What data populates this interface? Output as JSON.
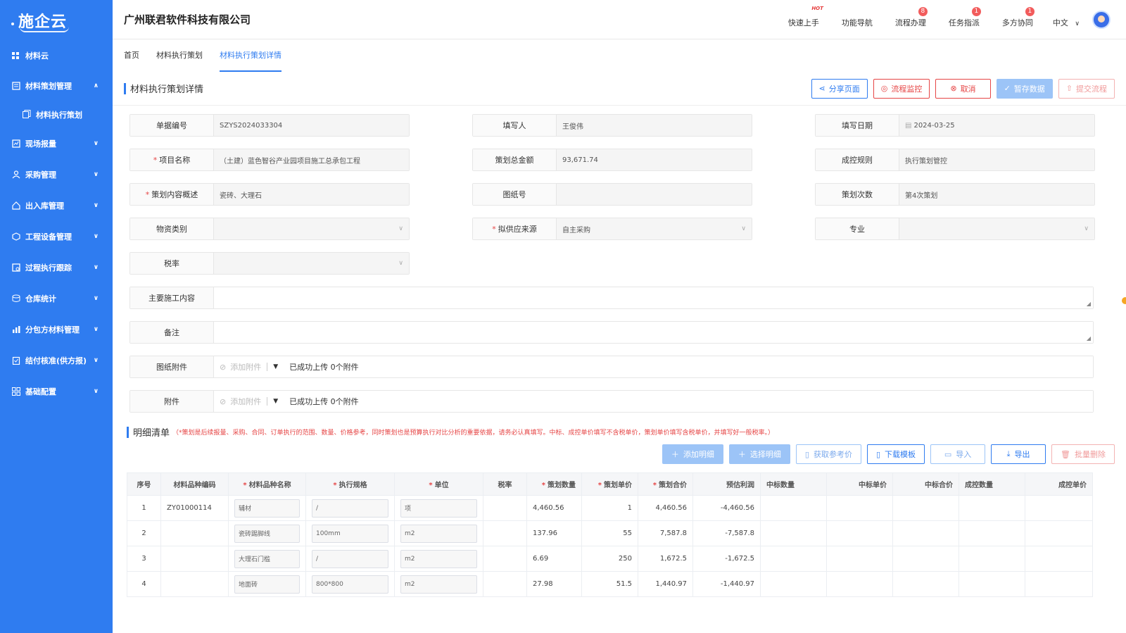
{
  "logo": {
    "text": "施企云"
  },
  "sidebar": {
    "items": [
      {
        "label": "材料云",
        "icon": "grid-icon",
        "chevron": ""
      },
      {
        "label": "材料策划管理",
        "icon": "ledger-icon",
        "chevron": "∧"
      },
      {
        "label": "材料执行策划",
        "icon": "doc-stack-icon",
        "chevron": ""
      },
      {
        "label": "现场报量",
        "icon": "report-icon",
        "chevron": "∨"
      },
      {
        "label": "采购管理",
        "icon": "people-icon",
        "chevron": "∨"
      },
      {
        "label": "出入库管理",
        "icon": "home-icon",
        "chevron": "∨"
      },
      {
        "label": "工程设备管理",
        "icon": "cube-icon",
        "chevron": "∨"
      },
      {
        "label": "过程执行跟踪",
        "icon": "track-icon",
        "chevron": "∨"
      },
      {
        "label": "仓库统计",
        "icon": "stack-icon",
        "chevron": "∨"
      },
      {
        "label": "分包方材料管理",
        "icon": "chart-icon",
        "chevron": "∨"
      },
      {
        "label": "结付核准(供方报)",
        "icon": "clipboard-icon",
        "chevron": "∨"
      },
      {
        "label": "基础配置",
        "icon": "apps-icon",
        "chevron": "∨"
      }
    ]
  },
  "header": {
    "company": "广州联君软件科技有限公司",
    "links": [
      {
        "label": "快速上手",
        "badge": "",
        "hot": "HOT"
      },
      {
        "label": "功能导航",
        "badge": "",
        "hot": ""
      },
      {
        "label": "流程办理",
        "badge": "8",
        "hot": ""
      },
      {
        "label": "任务指派",
        "badge": "1",
        "hot": ""
      },
      {
        "label": "多方协同",
        "badge": "1",
        "hot": ""
      }
    ],
    "lang": "中文"
  },
  "tabs": [
    {
      "label": "首页"
    },
    {
      "label": "材料执行策划"
    },
    {
      "label": "材料执行策划详情"
    }
  ],
  "page": {
    "title": "材料执行策划详情",
    "buttons": {
      "share": "分享页面",
      "flow": "流程监控",
      "cancel": "取消",
      "save": "暂存数据",
      "submit": "提交流程"
    }
  },
  "form": {
    "doc_no_label": "单据编号",
    "doc_no": "SZYS2024033304",
    "writer_label": "填写人",
    "writer": "王俊伟",
    "date_label": "填写日期",
    "date": "2024-03-25",
    "project_label": "项目名称",
    "project": "（土建）蓝色智谷产业园项目施工总承包工程",
    "total_label": "策划总金额",
    "total": "93,671.74",
    "rule_label": "成控规则",
    "rule": "执行策划管控",
    "summary_label": "策划内容概述",
    "summary": "瓷砖、大理石",
    "drawing_no_label": "图纸号",
    "drawing_no": "",
    "times_label": "策划次数",
    "times": "第4次策划",
    "category_label": "物资类别",
    "category": "",
    "source_label": "拟供应来源",
    "source": "自主采购",
    "major_label": "专业",
    "major": "",
    "tax_label": "税率",
    "tax": "",
    "main_content_label": "主要施工内容",
    "main_content": "",
    "remark_label": "备注",
    "remark": "",
    "drawing_attach_label": "图纸附件",
    "attach_label": "附件",
    "add_attach": "添加附件",
    "upload_msg": "已成功上传 0个附件"
  },
  "detail": {
    "title": "明细清单",
    "note": "（*策划是后续报量、采购、合同、订单执行的范围、数量、价格参考，同时策划也是预算执行对比分析的重要依据，请务必认真填写。中标、成控单价填写不含税单价，策划单价填写含税单价，并填写好一般税率。）",
    "buttons": {
      "add": "添加明细",
      "select": "选择明细",
      "ref": "获取参考价",
      "download": "下载模板",
      "import": "导入",
      "export": "导出",
      "batch_delete": "批量删除"
    },
    "columns": [
      "序号",
      "材料品种编码",
      "材料品种名称",
      "执行规格",
      "单位",
      "税率",
      "策划数量",
      "策划单价",
      "策划合价",
      "预估利润",
      "中标数量",
      "中标单价",
      "中标合价",
      "成控数量",
      "成控单价"
    ],
    "rows": [
      {
        "no": "1",
        "code": "ZY01000114",
        "name": "辅材",
        "spec": "/",
        "unit": "项",
        "tax": "",
        "qty": "4,460.56",
        "price": "1",
        "amount": "4,460.56",
        "profit": "-4,460.56"
      },
      {
        "no": "2",
        "code": "",
        "name": "瓷砖踢脚线",
        "spec": "100mm",
        "unit": "m2",
        "tax": "",
        "qty": "137.96",
        "price": "55",
        "amount": "7,587.8",
        "profit": "-7,587.8"
      },
      {
        "no": "3",
        "code": "",
        "name": "大理石门槛",
        "spec": "/",
        "unit": "m2",
        "tax": "",
        "qty": "6.69",
        "price": "250",
        "amount": "1,672.5",
        "profit": "-1,672.5"
      },
      {
        "no": "4",
        "code": "",
        "name": "地面砖",
        "spec": "800*800",
        "unit": "m2",
        "tax": "",
        "qty": "27.98",
        "price": "51.5",
        "amount": "1,440.97",
        "profit": "-1,440.97"
      }
    ]
  }
}
